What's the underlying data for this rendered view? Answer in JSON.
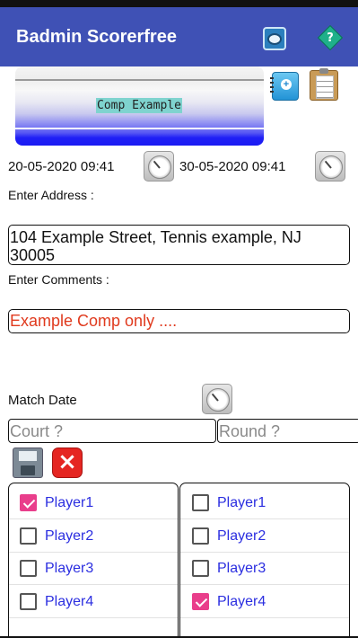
{
  "app": {
    "title": "Badmin Scorerfree",
    "colors": {
      "appbar": "#3f51b5",
      "comments_text": "#e03a1e",
      "player_text": "#2b2ee0",
      "check_accent": "#e93e8b"
    },
    "icons": [
      "camera-icon",
      "help-icon",
      "notebook-add-icon",
      "clipboard-icon",
      "clock-icon",
      "save-icon",
      "close-icon"
    ]
  },
  "competition": {
    "name": "Comp Example"
  },
  "dates": {
    "start": "20-05-2020 09:41",
    "end": "30-05-2020 09:41"
  },
  "address": {
    "label": "Enter Address :",
    "value": "104 Example Street, Tennis example, NJ 30005"
  },
  "comments": {
    "label": "Enter Comments :",
    "value": "Example Comp only ...."
  },
  "match": {
    "date_label": "Match Date",
    "court_placeholder": "Court ?",
    "round_placeholder": "Round ?"
  },
  "players_left": [
    {
      "name": "Player1",
      "checked": true
    },
    {
      "name": "Player2",
      "checked": false
    },
    {
      "name": "Player3",
      "checked": false
    },
    {
      "name": "Player4",
      "checked": false
    }
  ],
  "players_right": [
    {
      "name": "Player1",
      "checked": false
    },
    {
      "name": "Player2",
      "checked": false
    },
    {
      "name": "Player3",
      "checked": false
    },
    {
      "name": "Player4",
      "checked": true
    }
  ]
}
